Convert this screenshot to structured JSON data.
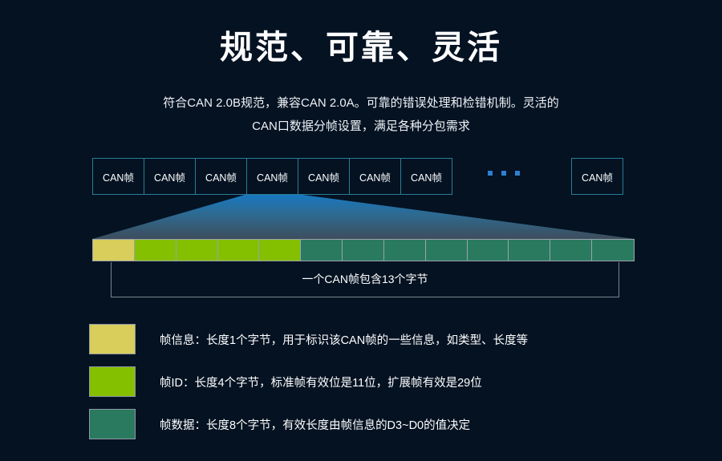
{
  "page": {
    "background_color": "#041222",
    "title": "规范、可靠、灵活",
    "subtitle_line1": "符合CAN 2.0B规范，兼容CAN 2.0A。可靠的错误处理和检错机制。灵活的",
    "subtitle_line2": "CAN口数据分帧设置，满足各种分包需求"
  },
  "frames": {
    "label": "CAN帧",
    "boxes": [
      {
        "label": "CAN帧"
      },
      {
        "label": "CAN帧"
      },
      {
        "label": "CAN帧"
      },
      {
        "label": "CAN帧"
      },
      {
        "label": "CAN帧"
      },
      {
        "label": "CAN帧"
      },
      {
        "label": "CAN帧"
      }
    ],
    "ellipsis_dots": 3,
    "last_box": {
      "label": "CAN帧"
    },
    "border_color": "#2a7d96",
    "dot_color": "#2e7fd4"
  },
  "funnel": {
    "gradient_top_color": "#1f7fc4",
    "gradient_bottom_color": "#3a4a58"
  },
  "byte_bar": {
    "total_bytes": 13,
    "border_color": "#9aa3ae",
    "segments": [
      {
        "kind": "info",
        "color": "#d9cd5c",
        "bytes": 1
      },
      {
        "kind": "id",
        "color": "#84bf00",
        "bytes": 1
      },
      {
        "kind": "id",
        "color": "#84bf00",
        "bytes": 1
      },
      {
        "kind": "id",
        "color": "#84bf00",
        "bytes": 1
      },
      {
        "kind": "id",
        "color": "#84bf00",
        "bytes": 1
      },
      {
        "kind": "data",
        "color": "#2a7a5f",
        "bytes": 1
      },
      {
        "kind": "data",
        "color": "#2a7a5f",
        "bytes": 1
      },
      {
        "kind": "data",
        "color": "#2a7a5f",
        "bytes": 1
      },
      {
        "kind": "data",
        "color": "#2a7a5f",
        "bytes": 1
      },
      {
        "kind": "data",
        "color": "#2a7a5f",
        "bytes": 1
      },
      {
        "kind": "data",
        "color": "#2a7a5f",
        "bytes": 1
      },
      {
        "kind": "data",
        "color": "#2a7a5f",
        "bytes": 1
      },
      {
        "kind": "data",
        "color": "#2a7a5f",
        "bytes": 1
      }
    ]
  },
  "bracket": {
    "caption": "一个CAN帧包含13个字节",
    "border_color": "#7d858f"
  },
  "legend": {
    "rows": [
      {
        "color": "#d9cd5c",
        "text": "帧信息：长度1个字节，用于标识该CAN帧的一些信息，如类型、长度等"
      },
      {
        "color": "#84bf00",
        "text": "帧ID：长度4个字节，标准帧有效位是11位，扩展帧有效是29位"
      },
      {
        "color": "#2a7a5f",
        "text": "帧数据：长度8个字节，有效长度由帧信息的D3~D0的值决定"
      }
    ]
  }
}
